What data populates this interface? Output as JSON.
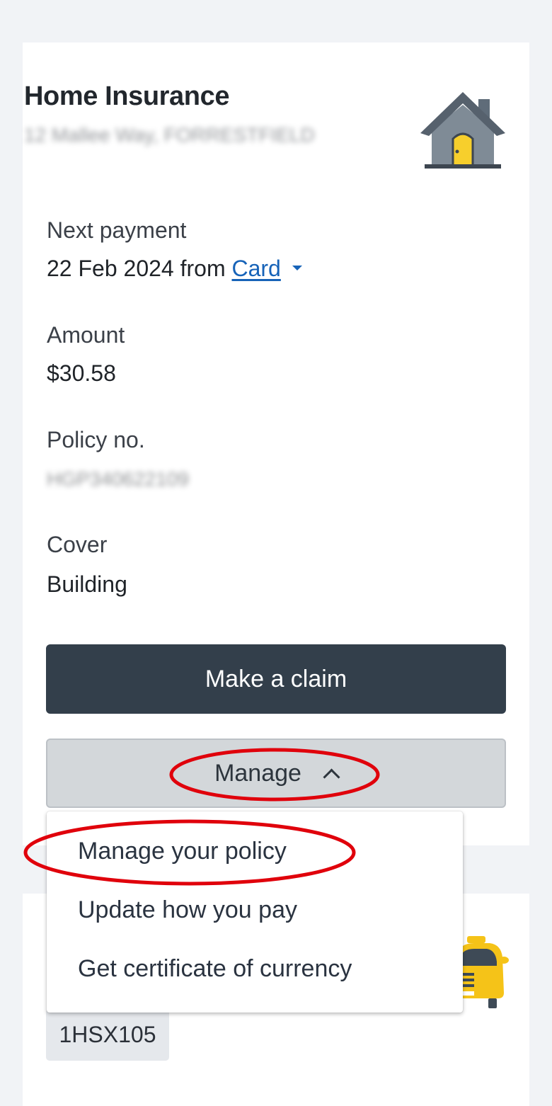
{
  "home_card": {
    "title": "Home Insurance",
    "address": "12 Mallee Way, FORRESTFIELD",
    "icon": "house-icon",
    "next_payment": {
      "label": "Next payment",
      "date_text": "22 Feb 2024 from ",
      "method": "Card"
    },
    "amount": {
      "label": "Amount",
      "value": "$30.58"
    },
    "policy": {
      "label": "Policy no.",
      "value": "HGP340622109"
    },
    "cover": {
      "label": "Cover",
      "value": "Building"
    },
    "claim_button": "Make a claim",
    "manage_button": "Manage"
  },
  "manage_menu": {
    "items": [
      "Manage your policy",
      "Update how you pay",
      "Get certificate of currency"
    ]
  },
  "car_card": {
    "registration": "1HSX105",
    "icon": "car-icon"
  },
  "colors": {
    "page_background": "#f1f3f6",
    "card_background": "#ffffff",
    "primary_button": "#333f4b",
    "secondary_button": "#d3d7da",
    "link": "#1763b8",
    "annotation": "#e0000b",
    "house_roof": "#5f6c79",
    "house_door": "#f7cf2c",
    "car_body": "#f5c318"
  }
}
